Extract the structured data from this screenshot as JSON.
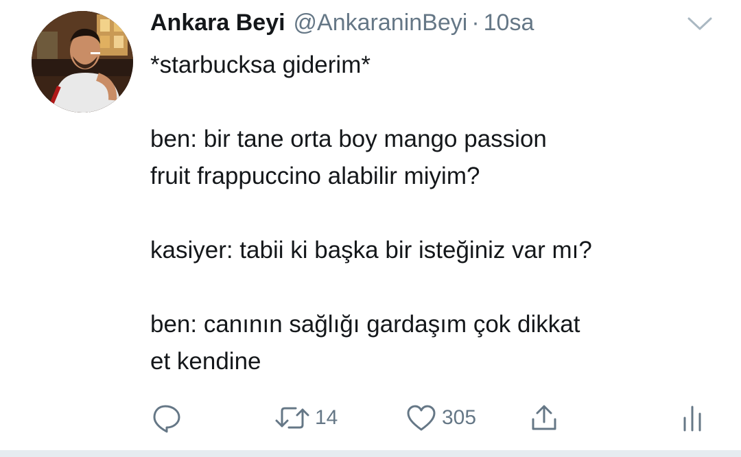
{
  "tweet": {
    "display_name": "Ankara Beyi",
    "handle": "@AnkaraninBeyi",
    "separator": "·",
    "time": "10sa",
    "lines": [
      "*starbucksa giderim*",
      "",
      "ben: bir tane orta boy mango passion",
      "fruit frappuccino alabilir miyim?",
      "",
      "kasiyer: tabii ki başka bir isteğiniz var mı?",
      "",
      "ben: canının sağlığı gardaşım çok dikkat",
      "et kendine"
    ]
  },
  "actions": {
    "retweet_count": "14",
    "like_count": "305"
  },
  "icons": {
    "reply": "reply-icon",
    "retweet": "retweet-icon",
    "like": "heart-icon",
    "share": "share-icon",
    "analytics": "analytics-icon",
    "menu": "chevron-down-icon"
  },
  "colors": {
    "text": "#14171a",
    "secondary": "#657786",
    "icon": "#657786",
    "divider": "#e6ecf0"
  }
}
